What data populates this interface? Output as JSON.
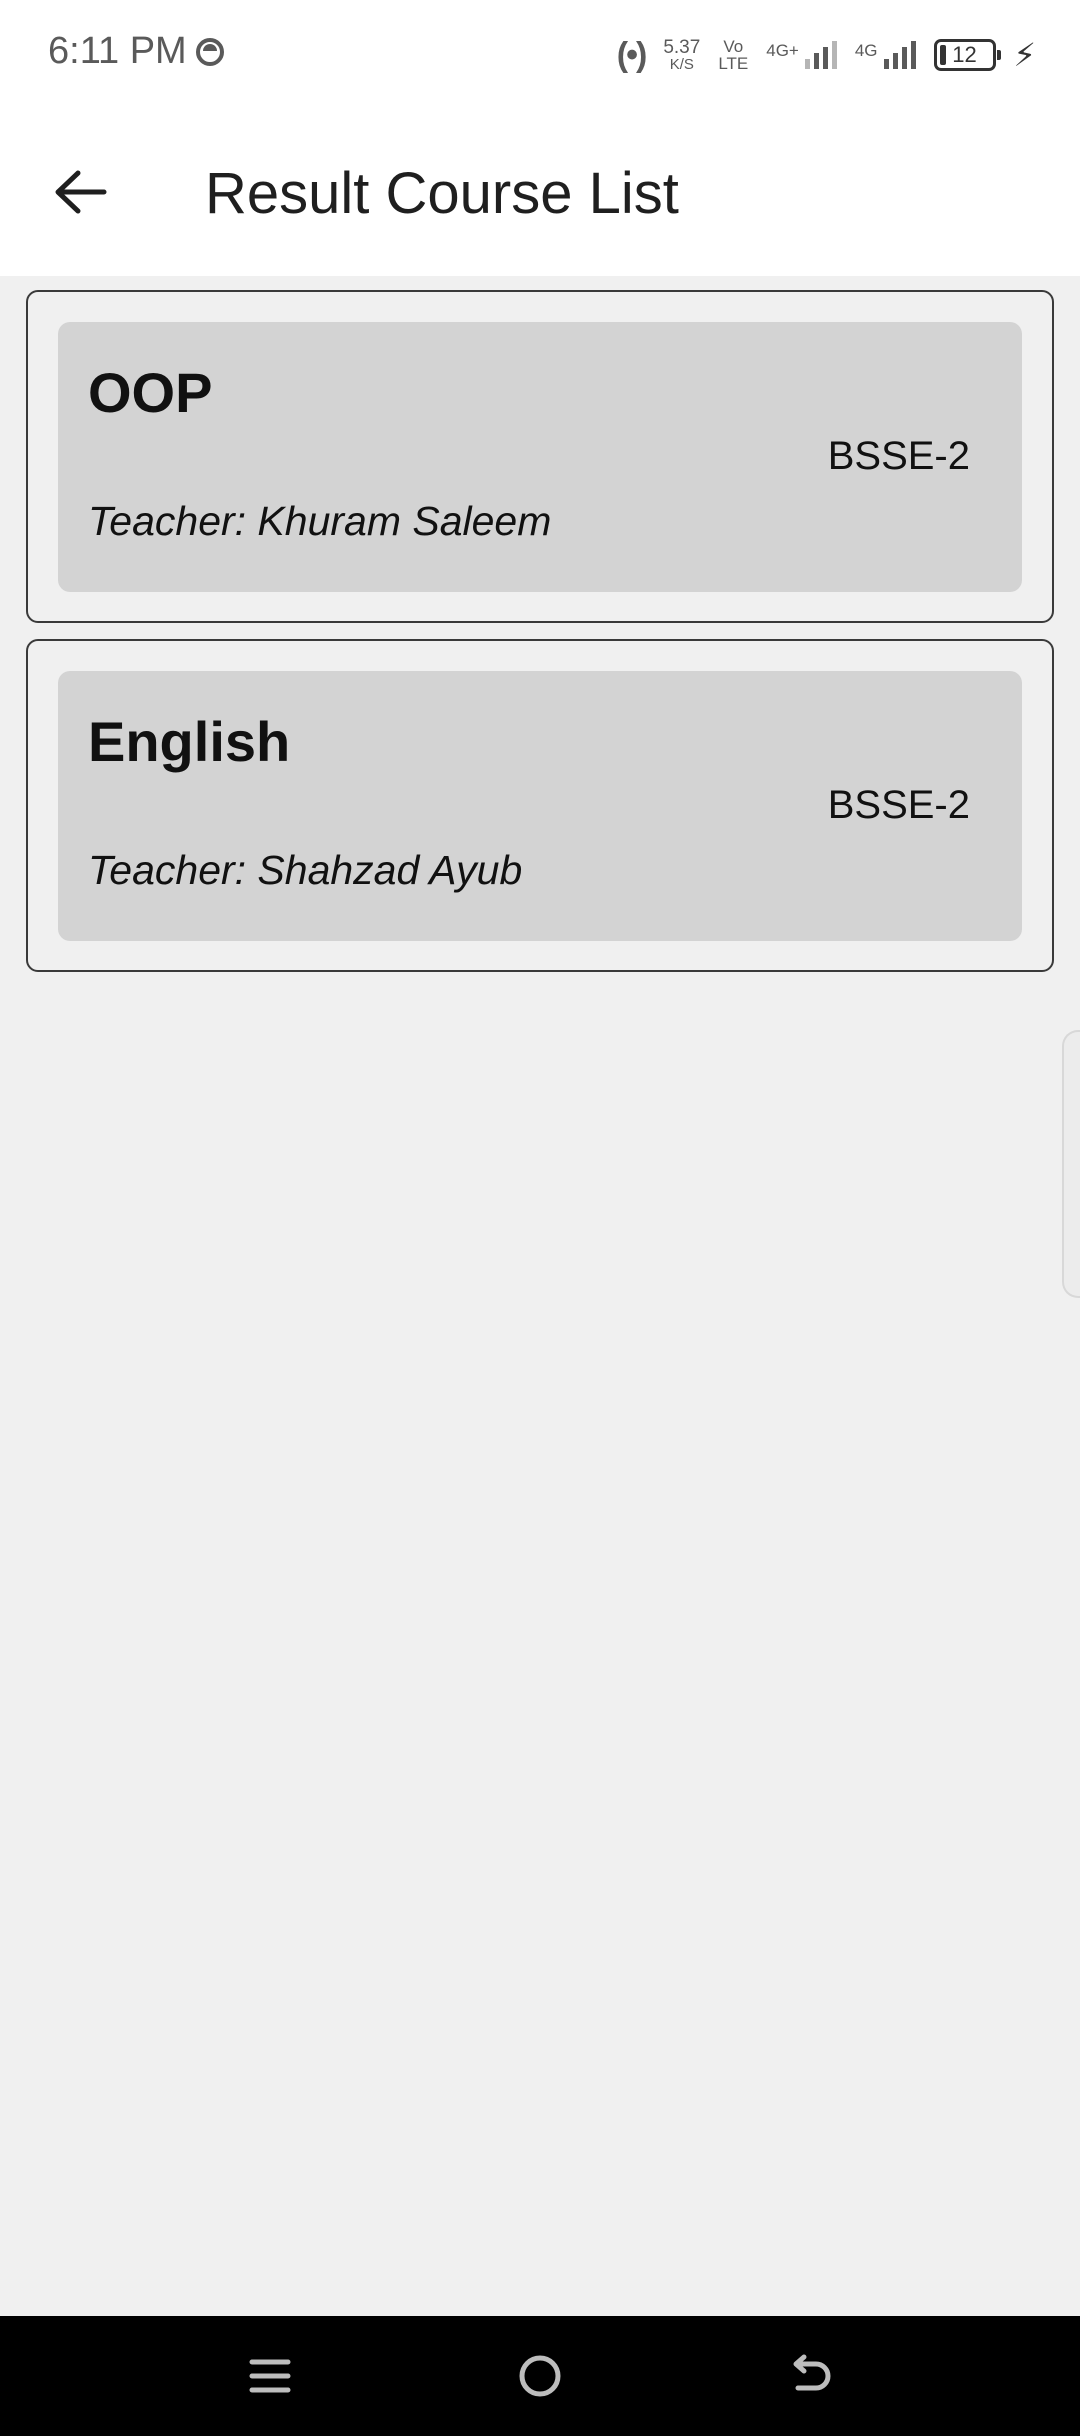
{
  "status": {
    "time": "6:11 PM",
    "speed_value": "5.37",
    "speed_unit": "K/S",
    "volte_top": "Vo",
    "volte_bottom": "LTE",
    "sim1_label": "4G+",
    "sim2_label": "4G",
    "battery_level": "12"
  },
  "app_bar": {
    "title": "Result Course List"
  },
  "courses": [
    {
      "name": "OOP",
      "class": "BSSE-2",
      "teacher": "Teacher: Khuram Saleem"
    },
    {
      "name": "English",
      "class": "BSSE-2",
      "teacher": "Teacher: Shahzad Ayub"
    }
  ],
  "icons": {
    "back": "arrow-left-icon",
    "nav_menu": "menu-icon",
    "nav_home": "home-circle-icon",
    "nav_back": "return-icon"
  },
  "colors": {
    "background": "#f0f0f0",
    "card": "#d3d3d3",
    "nav_bar": "#000000"
  }
}
